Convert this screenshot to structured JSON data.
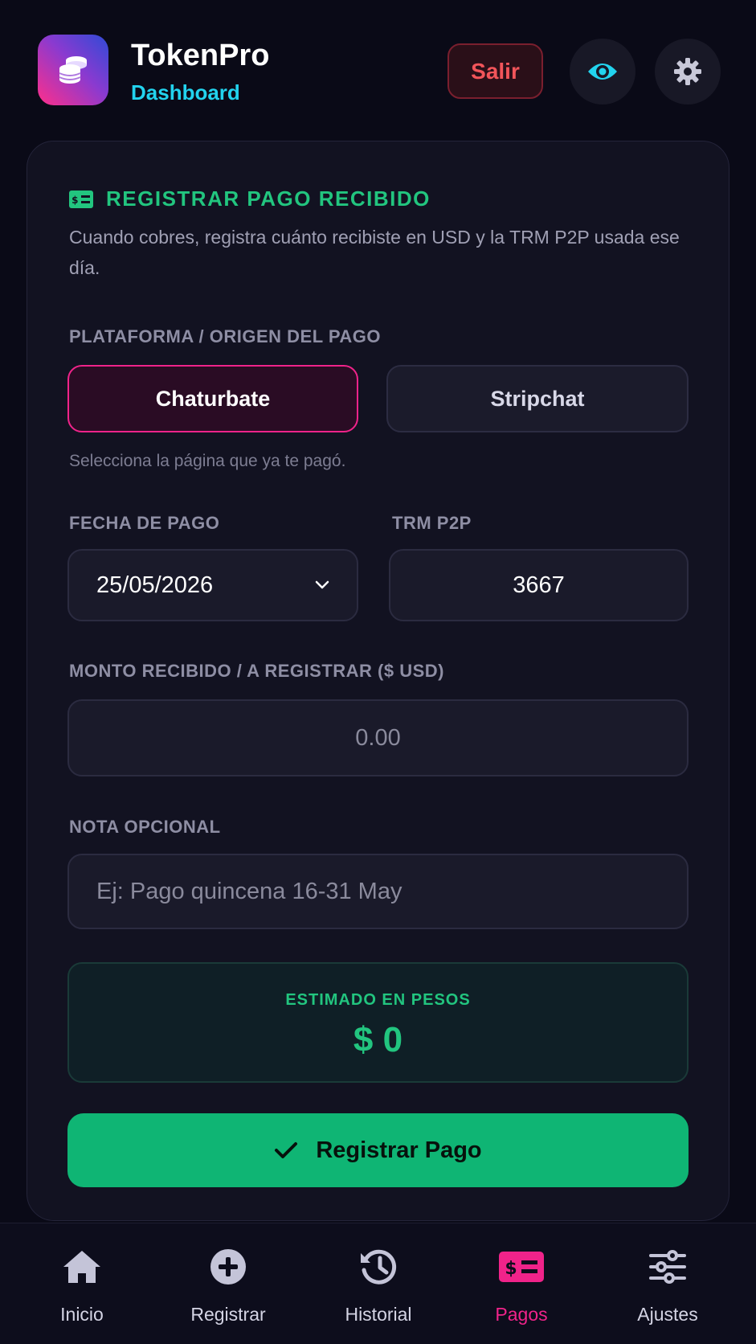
{
  "header": {
    "app_title": "TokenPro",
    "app_subtitle": "Dashboard",
    "logout_label": "Salir",
    "icons": [
      "coins-icon",
      "eye-icon",
      "gear-icon"
    ]
  },
  "form": {
    "section_title": "REGISTRAR PAGO RECIBIDO",
    "description": "Cuando cobres, registra cuánto recibiste en USD y la TRM P2P usada ese día.",
    "platform_label": "PLATAFORMA / ORIGEN DEL PAGO",
    "platforms": [
      {
        "label": "Chaturbate",
        "selected": true
      },
      {
        "label": "Stripchat",
        "selected": false
      }
    ],
    "platform_hint": "Selecciona la página que ya te pagó.",
    "date_label": "FECHA DE PAGO",
    "date_value": "25/05/2026",
    "trm_label": "TRM P2P",
    "trm_value": "3667",
    "amount_label": "MONTO RECIBIDO / A REGISTRAR ($ USD)",
    "amount_placeholder": "0.00",
    "note_label": "NOTA OPCIONAL",
    "note_placeholder": "Ej: Pago quincena 16-31 May",
    "estimate_label": "ESTIMADO EN PESOS",
    "estimate_value": "$ 0",
    "submit_label": "Registrar Pago"
  },
  "nav": {
    "items": [
      {
        "label": "Inicio",
        "icon": "home-icon",
        "active": false
      },
      {
        "label": "Registrar",
        "icon": "plus-circle-icon",
        "active": false
      },
      {
        "label": "Historial",
        "icon": "history-icon",
        "active": false
      },
      {
        "label": "Pagos",
        "icon": "money-bill-icon",
        "active": true
      },
      {
        "label": "Ajustes",
        "icon": "sliders-icon",
        "active": false
      }
    ]
  },
  "colors": {
    "background": "#0a0a17",
    "accent_pink": "#f0238a",
    "accent_green": "#22c57f",
    "accent_cyan": "#22d3ee",
    "danger": "#f2555a"
  }
}
